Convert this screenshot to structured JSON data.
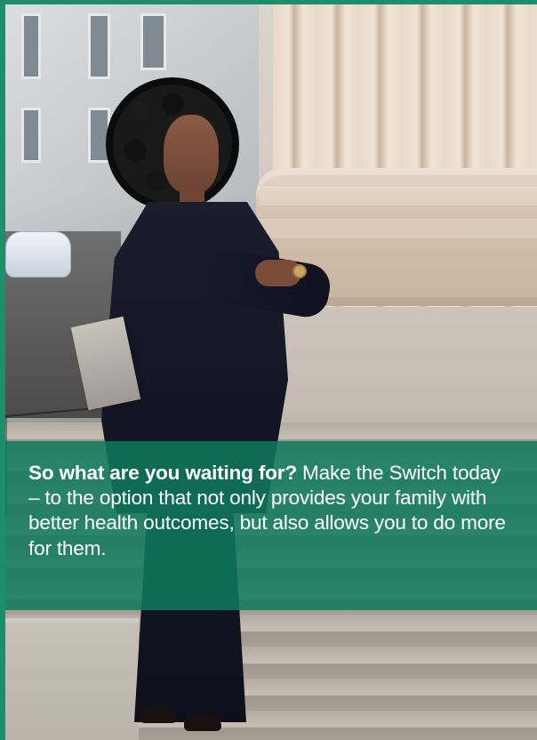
{
  "callout": {
    "headline": "So what are you waiting for?",
    "body": " Make the Switch today – to the option that not only provides your family with better health outcomes, but also allows you to do more for them."
  }
}
